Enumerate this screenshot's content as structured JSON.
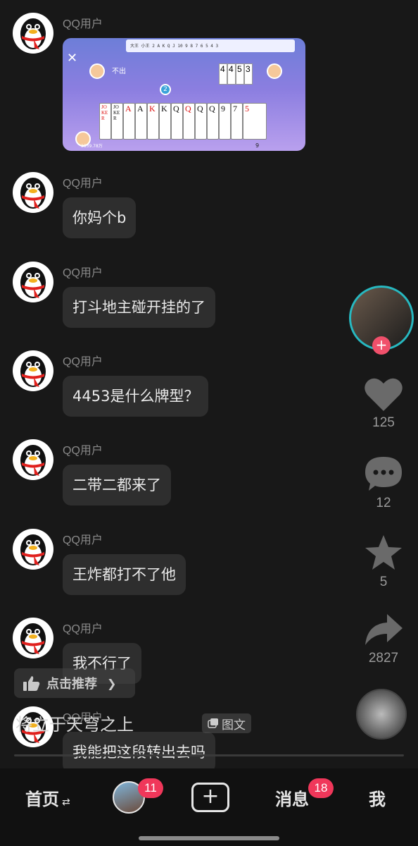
{
  "messages": [
    {
      "sender": "QQ用户",
      "type": "image"
    },
    {
      "sender": "QQ用户",
      "text": "你妈个b"
    },
    {
      "sender": "QQ用户",
      "text": "打斗地主碰开挂的了"
    },
    {
      "sender": "QQ用户",
      "text": "4453是什么牌型？"
    },
    {
      "sender": "QQ用户",
      "text": "二带二都来了"
    },
    {
      "sender": "QQ用户",
      "text": "王炸都打不了他"
    },
    {
      "sender": "QQ用户",
      "text": "我不行了"
    },
    {
      "sender": "QQ用户",
      "text": "我能把这段转出去吗"
    }
  ],
  "game": {
    "tracker": "大王 小王 2  A  K  Q  J  10  9  8  7  6  5  4  3",
    "pass_text": "不出",
    "played_cards": [
      "4",
      "4",
      "5",
      "3"
    ],
    "turn_number": "2",
    "hand": [
      {
        "rank": "JOKER",
        "color": "red"
      },
      {
        "rank": "JOKER",
        "color": "blk"
      },
      {
        "rank": "A",
        "color": "red"
      },
      {
        "rank": "A",
        "color": "blk"
      },
      {
        "rank": "K",
        "color": "red"
      },
      {
        "rank": "K",
        "color": "blk"
      },
      {
        "rank": "Q",
        "color": "blk"
      },
      {
        "rank": "Q",
        "color": "red"
      },
      {
        "rank": "Q",
        "color": "blk"
      },
      {
        "rank": "Q",
        "color": "blk"
      },
      {
        "rank": "9",
        "color": "blk"
      },
      {
        "rank": "7",
        "color": "blk"
      },
      {
        "rank": "5",
        "color": "red"
      }
    ],
    "coins": "3539.78万",
    "remaining": "9"
  },
  "recommend": {
    "label": "点击推荐"
  },
  "caption": {
    "title": "将立于天穹之上",
    "tag": "图文"
  },
  "actions": {
    "likes": "125",
    "comments": "12",
    "favorites": "5",
    "shares": "2827"
  },
  "colors": {
    "accent": "#f0375a",
    "ring": "#27b8c0",
    "bubble": "#2e2e2e"
  },
  "nav": {
    "home": "首页",
    "home_arrows": "⇄",
    "friends_badge": "11",
    "plus": "+",
    "messages": "消息",
    "messages_badge": "18",
    "me": "我"
  }
}
